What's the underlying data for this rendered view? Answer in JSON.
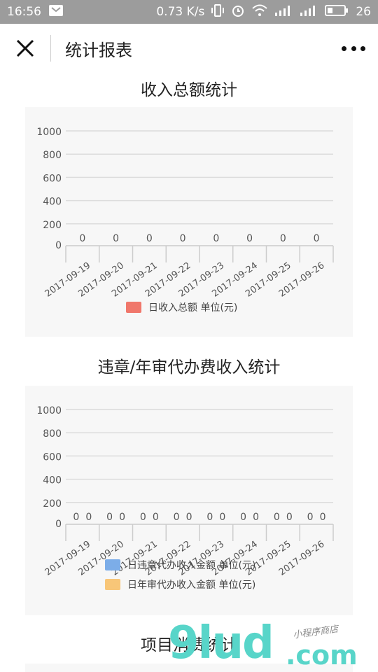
{
  "status_bar": {
    "time": "16:56",
    "speed": "0.73 K/s",
    "battery": "26",
    "icons": [
      "notification-icon",
      "vibrate-icon",
      "alarm-icon",
      "wifi-icon",
      "signal-icon",
      "signal-4g-icon",
      "battery-icon"
    ]
  },
  "nav": {
    "title": "统计报表",
    "close_icon": "close-icon",
    "more_icon": "more-icon"
  },
  "sections": [
    {
      "title": "收入总额统计"
    },
    {
      "title": "违章/年审代办费收入统计"
    },
    {
      "title": "项目消费统计"
    }
  ],
  "colors": {
    "series_red": "#f0776b",
    "series_blue": "#7cade8",
    "series_orange": "#f8c678",
    "grid": "#dcdcdc",
    "chart_bg": "#f7f7f7"
  },
  "watermark": {
    "text": "9lud",
    "suffix": ".com",
    "tagline": "小程序商店"
  },
  "chart_data": [
    {
      "type": "bar",
      "title": "收入总额统计",
      "categories": [
        "2017-09-19",
        "2017-09-20",
        "2017-09-21",
        "2017-09-22",
        "2017-09-23",
        "2017-09-24",
        "2017-09-25",
        "2017-09-26"
      ],
      "series": [
        {
          "name": "日收入总额  单位(元)",
          "values": [
            0,
            0,
            0,
            0,
            0,
            0,
            0,
            0
          ],
          "color": "#f0776b"
        }
      ],
      "ylim": [
        0,
        1000
      ],
      "yticks": [
        "0",
        "200",
        "400",
        "600",
        "800",
        "1000"
      ],
      "grid": true,
      "legend": "bottom"
    },
    {
      "type": "bar",
      "title": "违章/年审代办费收入统计",
      "categories": [
        "2017-09-19",
        "2017-09-20",
        "2017-09-21",
        "2017-09-22",
        "2017-09-23",
        "2017-09-24",
        "2017-09-25",
        "2017-09-26"
      ],
      "series": [
        {
          "name": "日违章代办收入金额  单位(元)",
          "values": [
            0,
            0,
            0,
            0,
            0,
            0,
            0,
            0
          ],
          "color": "#7cade8"
        },
        {
          "name": "日年审代办收入金额  单位(元)",
          "values": [
            0,
            0,
            0,
            0,
            0,
            0,
            0,
            0
          ],
          "color": "#f8c678"
        }
      ],
      "ylim": [
        0,
        1000
      ],
      "yticks": [
        "0",
        "200",
        "400",
        "600",
        "800",
        "1000"
      ],
      "grid": true,
      "legend": "bottom"
    }
  ]
}
